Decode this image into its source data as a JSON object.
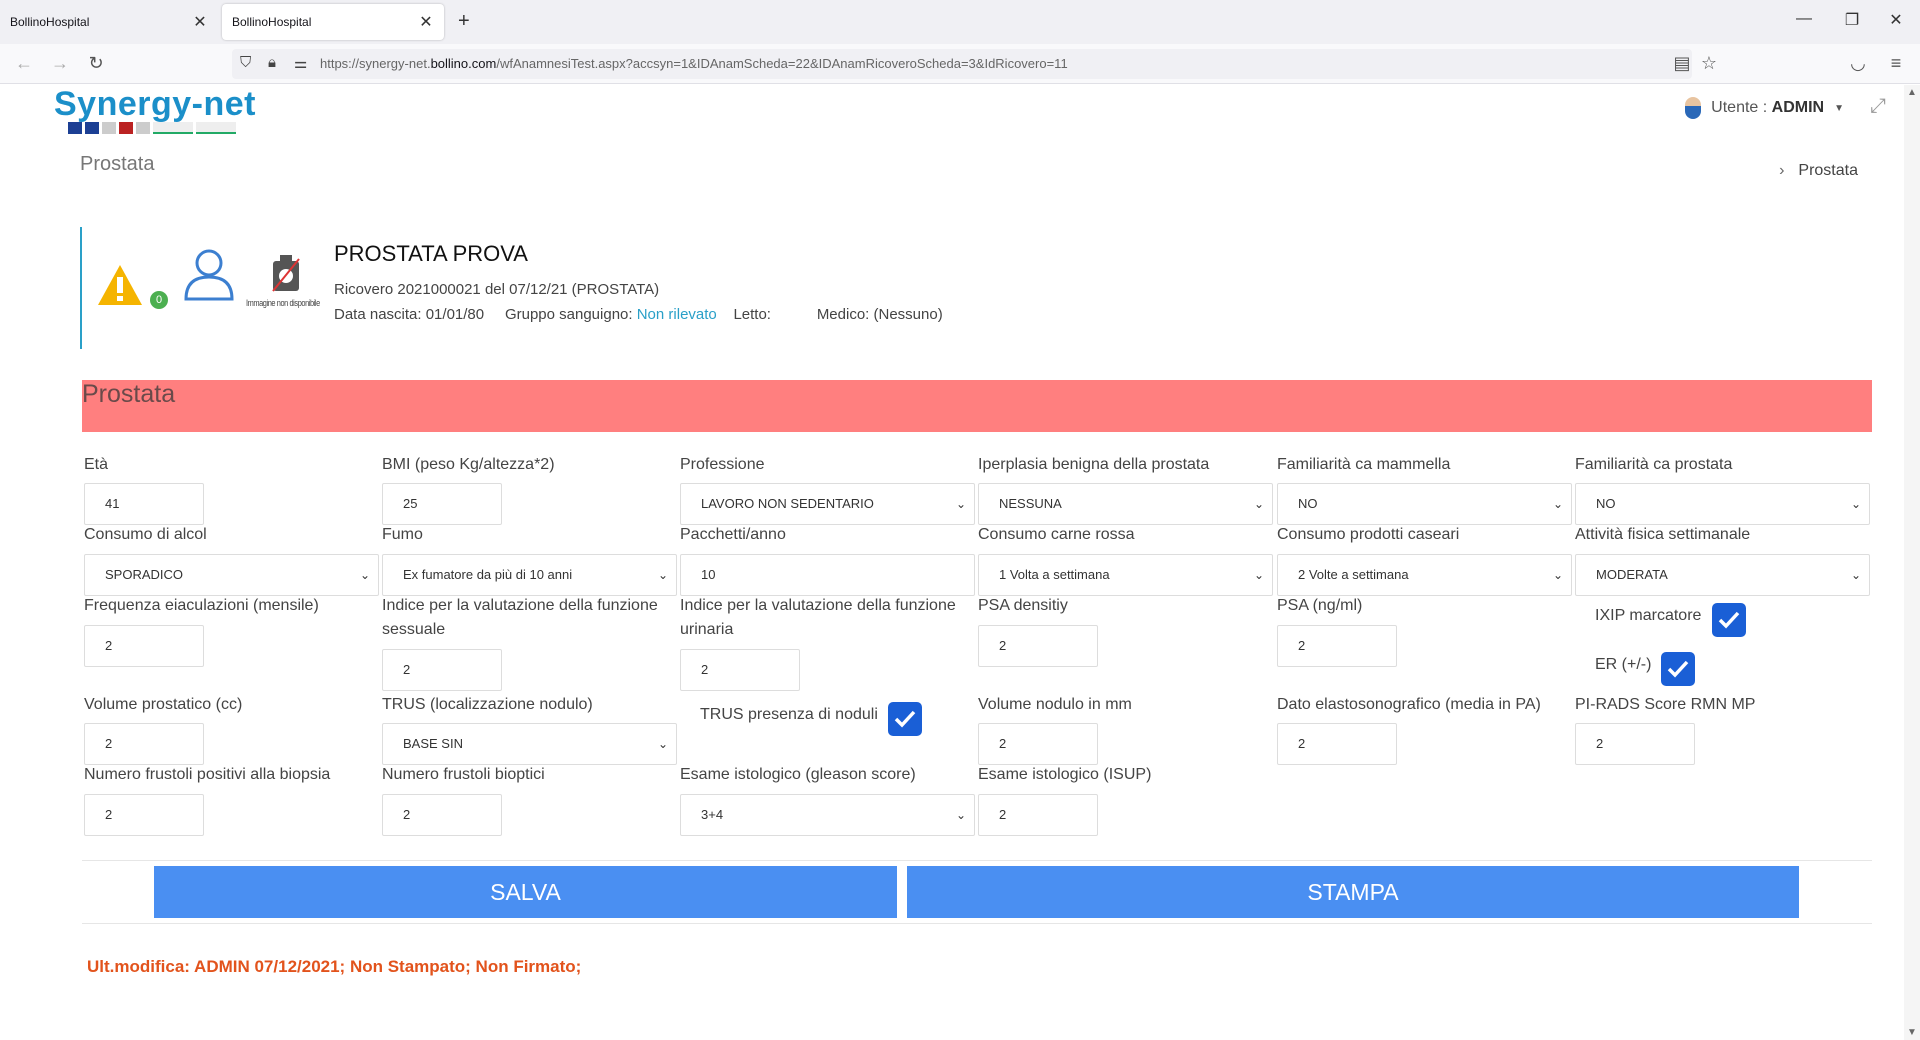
{
  "browser": {
    "tabs": [
      {
        "title": "BollinoHospital"
      },
      {
        "title": "BollinoHospital"
      }
    ],
    "url_prefix": "https://synergy-net.",
    "url_domain": "bollino.com",
    "url_path": "/wfAnamnesiTest.aspx?accsyn=1&IDAnamScheda=22&IDAnamRicoveroScheda=3&IdRicovero=11"
  },
  "header": {
    "logo": "Synergy-net",
    "user_label": "Utente : ",
    "user_name": "ADMIN"
  },
  "page": {
    "title": "Prostata",
    "breadcrumb": "Prostata"
  },
  "patient": {
    "alert_count": "0",
    "no_image_caption": "Immagine non disponibile",
    "name": "PROSTATA PROVA",
    "ricovero": "Ricovero 2021000021  del 07/12/21 (PROSTATA)",
    "birth": "Data nascita: 01/01/80",
    "blood_label": "Gruppo sanguigno: ",
    "blood_value": "Non rilevato",
    "bed": "Letto:",
    "doctor": "Medico: (Nessuno)"
  },
  "form": {
    "section_title": "Prostata",
    "eta": {
      "label": "Età",
      "value": "41"
    },
    "bmi": {
      "label": "BMI (peso Kg/altezza*2)",
      "value": "25"
    },
    "professione": {
      "label": "Professione",
      "value": "LAVORO NON SEDENTARIO"
    },
    "iperplasia": {
      "label": "Iperplasia benigna della prostata",
      "value": "NESSUNA"
    },
    "fam_mammella": {
      "label": "Familiarità ca mammella",
      "value": "NO"
    },
    "fam_prostata": {
      "label": "Familiarità ca prostata",
      "value": "NO"
    },
    "alcol": {
      "label": "Consumo di alcol",
      "value": "SPORADICO"
    },
    "fumo": {
      "label": "Fumo",
      "value": "Ex fumatore da più di 10 anni"
    },
    "pacchetti": {
      "label": "Pacchetti/anno",
      "value": "10"
    },
    "carne": {
      "label": "Consumo carne rossa",
      "value": "1 Volta a settimana"
    },
    "caseari": {
      "label": "Consumo prodotti caseari",
      "value": "2 Volte a settimana"
    },
    "attivita": {
      "label": "Attività fisica settimanale",
      "value": "MODERATA"
    },
    "eiaculazioni": {
      "label": "Frequenza eiaculazioni (mensile)",
      "value": "2"
    },
    "funz_sessuale": {
      "label_1": "Indice per la valutazione della funzione",
      "label_2": "sessuale",
      "value": "2"
    },
    "funz_urinaria": {
      "label_1": "Indice per la valutazione della funzione",
      "label_2": "urinaria",
      "value": "2"
    },
    "psa_density": {
      "label": "PSA densitiy",
      "value": "2"
    },
    "psa": {
      "label": "PSA (ng/ml)",
      "value": "2"
    },
    "ixip": {
      "label": "IXIP marcatore"
    },
    "er": {
      "label": "ER (+/-)"
    },
    "volume": {
      "label": "Volume prostatico (cc)",
      "value": "2"
    },
    "trus_loc": {
      "label": "TRUS (localizzazione nodulo)",
      "value": "BASE SIN"
    },
    "trus_noduli": {
      "label": "TRUS presenza di noduli"
    },
    "vol_nodulo": {
      "label": "Volume nodulo in mm",
      "value": "2"
    },
    "elasto": {
      "label": "Dato elastosonografico (media in PA)",
      "value": "2"
    },
    "pirads": {
      "label": "PI-RADS Score RMN MP",
      "value": "2"
    },
    "frustoli_pos": {
      "label": "Numero frustoli positivi alla biopsia",
      "value": "2"
    },
    "frustoli": {
      "label": "Numero frustoli bioptici",
      "value": "2"
    },
    "gleason": {
      "label": "Esame istologico (gleason score)",
      "value": "3+4"
    },
    "isup": {
      "label": "Esame istologico (ISUP)",
      "value": "2"
    }
  },
  "actions": {
    "save": "SALVA",
    "print": "STAMPA"
  },
  "footer": {
    "note": "Ult.modifica: ADMIN 07/12/2021; Non Stampato; Non Firmato;"
  }
}
